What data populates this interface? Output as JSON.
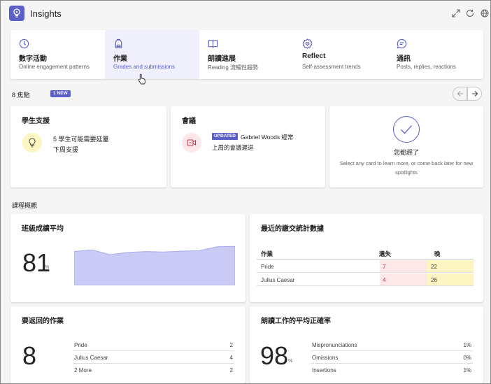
{
  "header": {
    "title": "Insights"
  },
  "tabs": [
    {
      "label": "數字活動",
      "subtitle": "Online engagement patterns",
      "icon": "clock-icon"
    },
    {
      "label": "作業",
      "subtitle": "Grades and submissions",
      "icon": "backpack-icon"
    },
    {
      "label": "朗讀進展",
      "subtitle": "Reading 流暢性趨勢",
      "icon": "book-icon"
    },
    {
      "label": "Reflect",
      "subtitle": "Self-assessment trends",
      "icon": "heart-badge-icon"
    },
    {
      "label": "通訊",
      "subtitle": "Posts, replies, reactions",
      "icon": "chat-icon"
    }
  ],
  "spotlights": {
    "count_label": "8 焦點",
    "new_badge": "1 NEW",
    "cards": {
      "support": {
        "title": "學生支援",
        "line1": "5 學生可能需要延屢",
        "line2": "下周支援"
      },
      "meetings": {
        "title": "會議",
        "badge": "UPDATED",
        "line1": "Gabriel Woods 經常",
        "line2": "上周的會議遲退"
      },
      "caught_up": {
        "title": "您都趕了",
        "text": "Select any card to learn more, or come back later for new spotlights"
      }
    }
  },
  "overview": {
    "title": "課程概觀",
    "grade_average": {
      "title": "班級成績平均",
      "value": "81",
      "unit": "%",
      "trend": [
        0.78,
        0.82,
        0.71,
        0.76,
        0.78,
        0.77,
        0.79,
        0.8,
        0.89,
        0.9
      ]
    },
    "submissions": {
      "title": "最近的繳交統計數據",
      "col_assignment": "作業",
      "col_missing": "遺失",
      "col_late": "晚",
      "rows": [
        {
          "name": "Pride",
          "missing": "7",
          "late": "22"
        },
        {
          "name": "Julius Caesar",
          "missing": "4",
          "late": "26"
        }
      ],
      "colors": {
        "missing": "#fde7e9",
        "late": "#fdf6c3"
      }
    },
    "to_return": {
      "title": "要返回的作業",
      "value": "8",
      "rows": [
        {
          "name": "Pride",
          "count": "2"
        },
        {
          "name": "Julius Caesar",
          "count": "4"
        },
        {
          "name": "2 More",
          "count": "2"
        }
      ]
    },
    "accuracy": {
      "title": "朗讀工作的平均正確率",
      "value": "98",
      "unit": "%",
      "rows": [
        {
          "name": "Mispronunciations",
          "value": "1%"
        },
        {
          "name": "Omissions",
          "value": "0%"
        },
        {
          "name": "Insertions",
          "value": "1%"
        }
      ]
    }
  },
  "colors": {
    "accent": "#5b5fc7",
    "chart_fill": "#c9cbf4",
    "chart_line": "#a8abe8"
  }
}
